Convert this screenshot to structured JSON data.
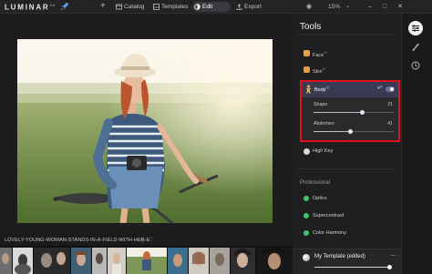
{
  "app": {
    "logo": "LUMINAR",
    "version": "4.3"
  },
  "toolbar": {
    "catalog": "Catalog",
    "templates": "Templates",
    "edit": "Edit",
    "export": "Export",
    "zoom": "15%"
  },
  "panel": {
    "title": "Tools",
    "face_label": "Face",
    "skin_label": "Skin",
    "body": {
      "label": "Body",
      "shape_label": "Shape",
      "shape_value": 21,
      "abdomen_label": "Abdomen",
      "abdomen_value": 41
    },
    "highkey_label": "High Key",
    "professional_section": "Professional",
    "optics_label": "Optics",
    "supercontrast_label": "Supercontrast",
    "colorharmony_label": "Color Harmony",
    "template_name": "My Template (edited)",
    "template_amount": 1.0
  },
  "filmstrip": {
    "filename": "LOVELY-YOUNG-WOMAN-STANDS-IN-A-FIELD-WITH-HER-E"
  },
  "colors": {
    "accent": "#e0121c",
    "panel_bg": "#1f1f21",
    "face_icon": "#e8a43a",
    "skin_icon": "#e79a3e",
    "body_icon": "#e8b23a",
    "highkey_icon": "#d8d8d8",
    "professional_icon": "#3cc86a"
  },
  "icons": [
    "rocket-icon",
    "plus-icon",
    "catalog-icon",
    "templates-icon",
    "edit-icon",
    "export-icon",
    "eye-icon",
    "chevron-down-icon",
    "minimize-icon",
    "maximize-icon",
    "close-icon",
    "sliders-icon",
    "brush-icon",
    "history-icon",
    "person-icon",
    "undo-icon",
    "toggle-icon",
    "info-icon",
    "heart-icon",
    "more-icon"
  ]
}
